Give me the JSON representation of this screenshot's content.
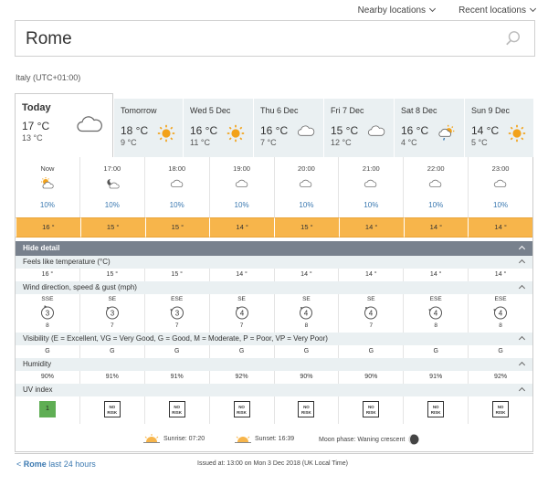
{
  "nav": {
    "nearby": "Nearby locations",
    "recent": "Recent locations"
  },
  "search": {
    "value": "Rome"
  },
  "location_info": "Italy (UTC+01:00)",
  "days": [
    {
      "name": "Today",
      "hi": "17 °C",
      "lo": "13 °C",
      "icon": "cloud-icon"
    },
    {
      "name": "Tomorrow",
      "hi": "18 °C",
      "lo": "9 °C",
      "icon": "sun-icon"
    },
    {
      "name": "Wed 5 Dec",
      "hi": "16 °C",
      "lo": "11 °C",
      "icon": "sun-icon"
    },
    {
      "name": "Thu 6 Dec",
      "hi": "16 °C",
      "lo": "7 °C",
      "icon": "cloud-icon"
    },
    {
      "name": "Fri 7 Dec",
      "hi": "15 °C",
      "lo": "12 °C",
      "icon": "cloud-icon"
    },
    {
      "name": "Sat 8 Dec",
      "hi": "16 °C",
      "lo": "4 °C",
      "icon": "sun-cloud-rain-icon"
    },
    {
      "name": "Sun 9 Dec",
      "hi": "14 °C",
      "lo": "5 °C",
      "icon": "sun-icon"
    }
  ],
  "hours": [
    {
      "time": "Now",
      "precip": "10%",
      "temp": "16 °",
      "feels": "16 °",
      "wind_dir": "SSE",
      "wind": "3",
      "gust": "8",
      "vis": "G",
      "hum": "90%",
      "uv": "1"
    },
    {
      "time": "17:00",
      "precip": "10%",
      "temp": "15 °",
      "feels": "15 °",
      "wind_dir": "SE",
      "wind": "3",
      "gust": "7",
      "vis": "G",
      "hum": "91%",
      "uv": "NO RISK"
    },
    {
      "time": "18:00",
      "precip": "10%",
      "temp": "15 °",
      "feels": "15 °",
      "wind_dir": "ESE",
      "wind": "3",
      "gust": "7",
      "vis": "G",
      "hum": "91%",
      "uv": "NO RISK"
    },
    {
      "time": "19:00",
      "precip": "10%",
      "temp": "14 °",
      "feels": "14 °",
      "wind_dir": "SE",
      "wind": "4",
      "gust": "7",
      "vis": "G",
      "hum": "92%",
      "uv": "NO RISK"
    },
    {
      "time": "20:00",
      "precip": "10%",
      "temp": "15 °",
      "feels": "14 °",
      "wind_dir": "SE",
      "wind": "4",
      "gust": "8",
      "vis": "G",
      "hum": "90%",
      "uv": "NO RISK"
    },
    {
      "time": "21:00",
      "precip": "10%",
      "temp": "14 °",
      "feels": "14 °",
      "wind_dir": "SE",
      "wind": "4",
      "gust": "7",
      "vis": "G",
      "hum": "90%",
      "uv": "NO RISK"
    },
    {
      "time": "22:00",
      "precip": "10%",
      "temp": "14 °",
      "feels": "14 °",
      "wind_dir": "ESE",
      "wind": "4",
      "gust": "8",
      "vis": "G",
      "hum": "91%",
      "uv": "NO RISK"
    },
    {
      "time": "23:00",
      "precip": "10%",
      "temp": "14 °",
      "feels": "14 °",
      "wind_dir": "ESE",
      "wind": "4",
      "gust": "8",
      "vis": "G",
      "hum": "92%",
      "uv": "NO RISK"
    }
  ],
  "detail": {
    "hide": "Hide detail",
    "feels_label": "Feels like temperature (°C)",
    "wind_label": "Wind direction, speed & gust (mph)",
    "vis_label": "Visibility (E = Excellent, VG = Very Good, G = Good, M = Moderate, P = Poor, VP = Very Poor)",
    "hum_label": "Humidity",
    "uv_label": "UV index"
  },
  "sun": {
    "sunrise": "Sunrise: 07:20",
    "sunset": "Sunset: 16:39",
    "moon": "Moon phase: Waning crescent"
  },
  "footer": {
    "back_loc": "Rome",
    "back_rest": " last 24 hours",
    "back_prefix": "< ",
    "issued": "Issued at: 13:00 on Mon 3 Dec 2018 (UK Local Time)"
  },
  "colors": {
    "accent": "#f7b54b",
    "link": "#3a78b0",
    "uv_low": "#5fae54"
  }
}
